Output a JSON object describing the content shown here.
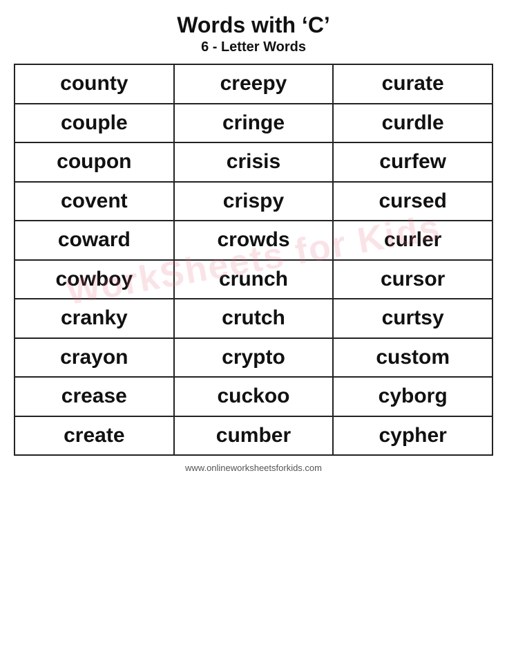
{
  "header": {
    "title": "Words with ‘C’",
    "subtitle": "6 - Letter Words"
  },
  "table": {
    "rows": [
      [
        "county",
        "creepy",
        "curate"
      ],
      [
        "couple",
        "cringe",
        "curdle"
      ],
      [
        "coupon",
        "crisis",
        "curfew"
      ],
      [
        "covent",
        "crispy",
        "cursed"
      ],
      [
        "coward",
        "crowds",
        "curler"
      ],
      [
        "cowboy",
        "crunch",
        "cursor"
      ],
      [
        "cranky",
        "crutch",
        "curtsy"
      ],
      [
        "crayon",
        "crypto",
        "custom"
      ],
      [
        "crease",
        "cuckoo",
        "cyborg"
      ],
      [
        "create",
        "cumber",
        "cypher"
      ]
    ]
  },
  "watermark": "WorkSheets for Kids",
  "footer": "www.onlineworksheetsforkids.com"
}
